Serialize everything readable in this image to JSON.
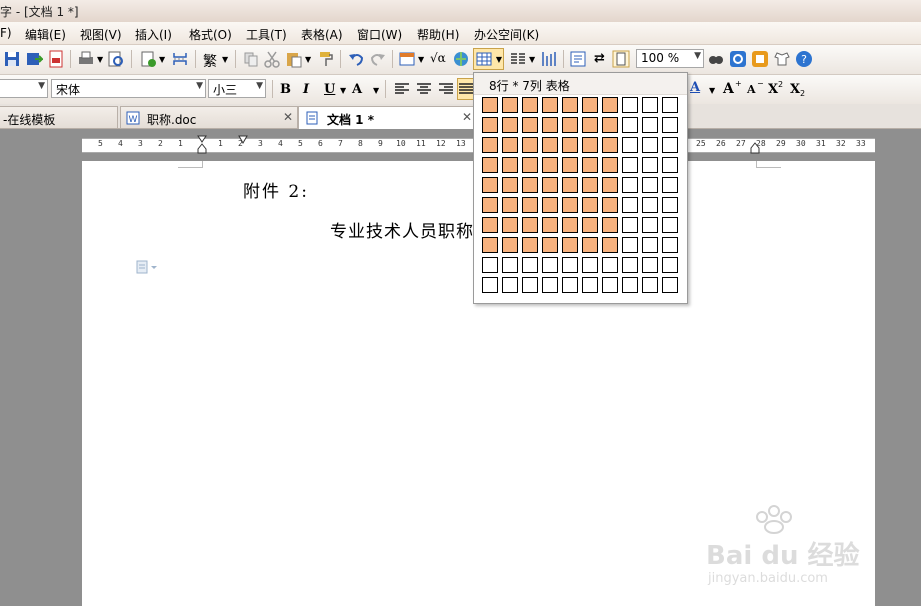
{
  "window": {
    "title": "字 - [文档 1 *]"
  },
  "menu": [
    "F)",
    "编辑(E)",
    "视图(V)",
    "插入(I)",
    "格式(O)",
    "工具(T)",
    "表格(A)",
    "窗口(W)",
    "帮助(H)",
    "办公空间(K)"
  ],
  "toolbar": {
    "zoom": "100 %"
  },
  "format_bar": {
    "font_name": "宋体",
    "font_size": "小三",
    "bold": "B",
    "italic": "I",
    "underline": "U",
    "font_a": "A",
    "grow": "A",
    "shrink": "A",
    "superscript": "X",
    "subscript": "X"
  },
  "tabs": [
    {
      "label": "-在线模板"
    },
    {
      "label": "职称.doc"
    },
    {
      "label": "文档 1 *"
    }
  ],
  "ruler_numbers": [
    "5",
    "4",
    "3",
    "2",
    "1",
    "1",
    "2",
    "3",
    "4",
    "5",
    "6",
    "7",
    "8",
    "9",
    "10",
    "11",
    "12",
    "13",
    "25",
    "26",
    "27",
    "28",
    "29",
    "30",
    "31",
    "32",
    "33"
  ],
  "document": {
    "line1": "附件 2:",
    "line2": "专业技术人员职称"
  },
  "table_picker": {
    "caption": "8行 * 7列 表格",
    "rows": 10,
    "cols": 10,
    "selected_rows": 8,
    "selected_cols": 7
  },
  "watermark": {
    "brand": "Bai du 经验",
    "url": "jingyan.baidu.com"
  },
  "colors": {
    "selected_cell": "#f7b27f",
    "accent_blue": "#1f4fb4"
  }
}
